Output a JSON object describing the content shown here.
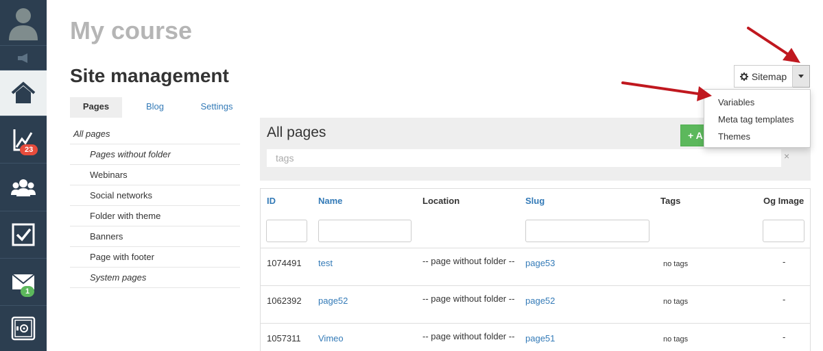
{
  "sidebar": {
    "stats_badge": "23",
    "mail_badge": "1"
  },
  "header": {
    "course_title": "My course",
    "page_title": "Site management"
  },
  "sitemap_button": {
    "label": "Sitemap"
  },
  "sitemap_menu": {
    "items": [
      "Variables",
      "Meta tag templates",
      "Themes"
    ]
  },
  "tabs": [
    "Pages",
    "Blog",
    "Settings"
  ],
  "folders": {
    "root": "All pages",
    "items": [
      "Pages without folder",
      "Webinars",
      "Social networks",
      "Folder with theme",
      "Banners",
      "Page with footer",
      "System pages"
    ]
  },
  "panel": {
    "title": "All pages",
    "add_label": "A",
    "tags_placeholder": "tags",
    "clear_symbol": "×"
  },
  "table": {
    "columns": [
      "ID",
      "Name",
      "Location",
      "Slug",
      "Tags",
      "Og Image"
    ],
    "rows": [
      {
        "id": "1074491",
        "name": "test",
        "location": "-- page without folder --",
        "slug": "page53",
        "tags": "no tags",
        "og": "-"
      },
      {
        "id": "1062392",
        "name": "page52",
        "location": "-- page without folder --",
        "slug": "page52",
        "tags": "no tags",
        "og": "-"
      },
      {
        "id": "1057311",
        "name": "Vimeo",
        "location": "-- page without folder --",
        "slug": "page51",
        "tags": "no tags",
        "og": "-"
      }
    ]
  },
  "colors": {
    "sidebar": "#2c3e50",
    "link": "#337ab7",
    "success": "#5cb85c",
    "danger": "#e74c3c",
    "arrow": "#c0181f"
  }
}
